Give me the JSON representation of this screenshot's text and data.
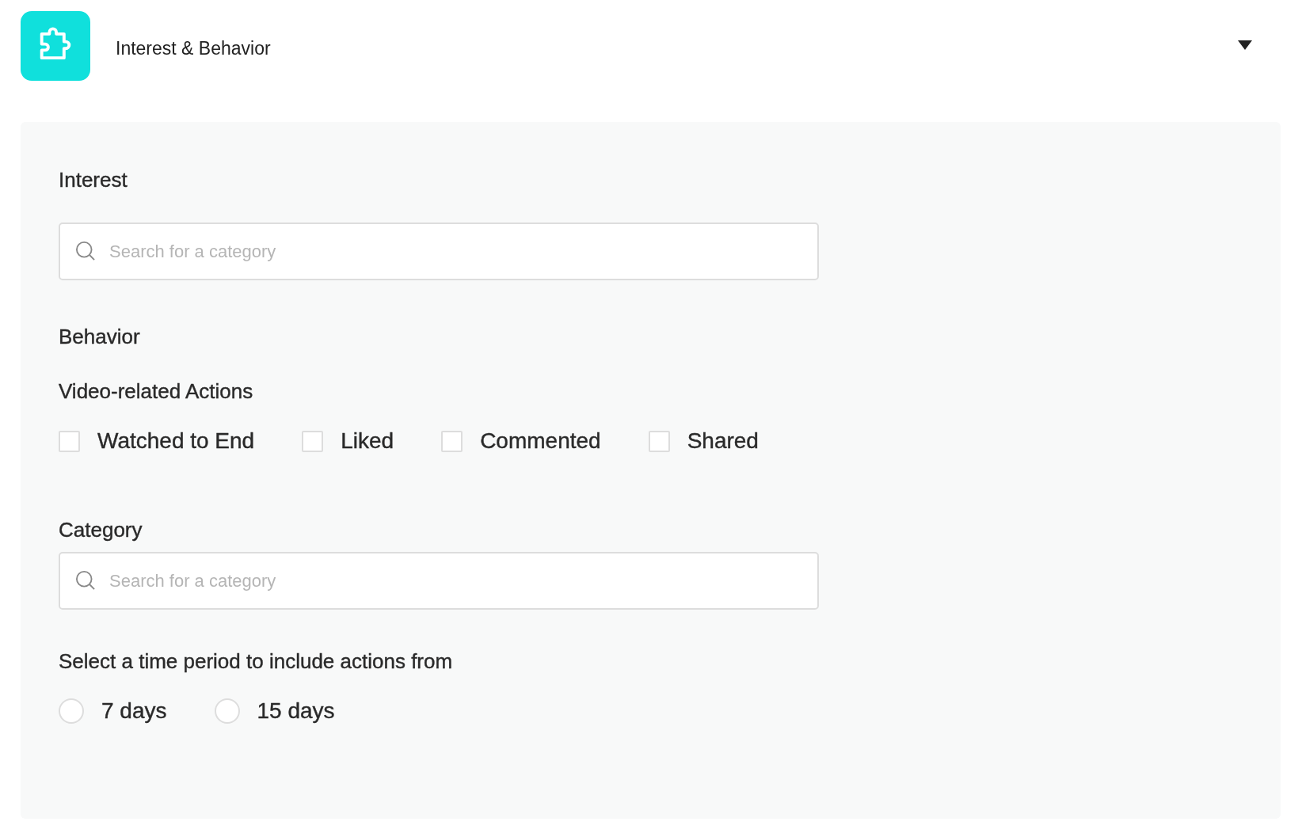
{
  "header": {
    "title": "Interest & Behavior",
    "expanded": true
  },
  "interest": {
    "label": "Interest",
    "search": {
      "placeholder": "Search for a category"
    }
  },
  "behavior": {
    "label": "Behavior",
    "subheading": "Video-related Actions",
    "actions": [
      {
        "label": "Watched to End",
        "checked": false
      },
      {
        "label": "Liked",
        "checked": false
      },
      {
        "label": "Commented",
        "checked": false
      },
      {
        "label": "Shared",
        "checked": false
      }
    ]
  },
  "category": {
    "label": "Category",
    "search": {
      "placeholder": "Search for a category"
    }
  },
  "time_period": {
    "label": "Select a time period to include actions from",
    "options": [
      {
        "label": "7 days",
        "selected": false
      },
      {
        "label": "15 days",
        "selected": false
      }
    ]
  }
}
